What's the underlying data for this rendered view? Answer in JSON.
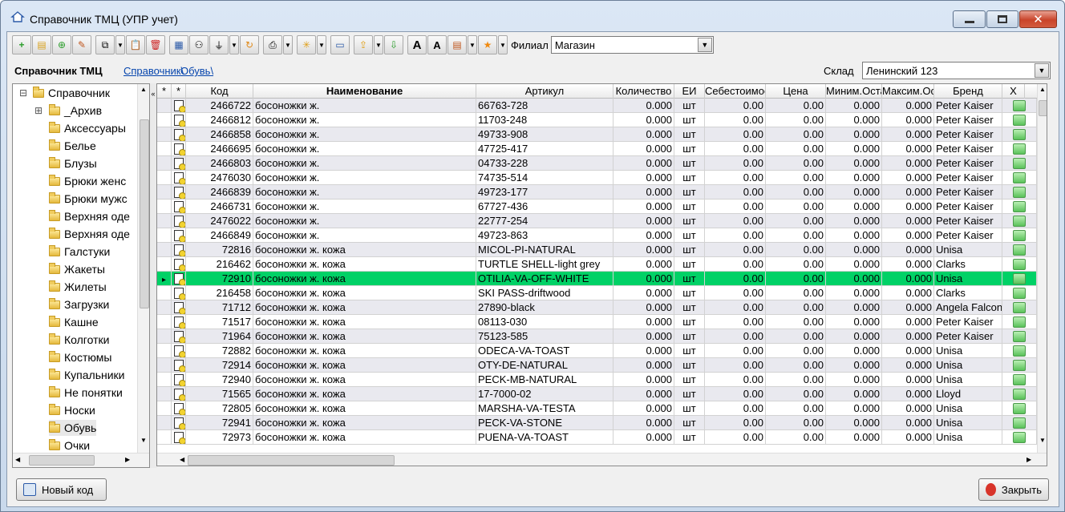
{
  "window": {
    "title": "Справочник ТМЦ (УПР учет)"
  },
  "toolbar": {
    "filial_label": "Филиал",
    "filial_value": "Магазин"
  },
  "breadcrumb": {
    "title": "Справочник ТМЦ",
    "links": [
      "Справочник\\",
      "Обувь\\"
    ]
  },
  "sklad": {
    "label": "Склад",
    "value": "Ленинский 123"
  },
  "tree": {
    "root": "Справочник",
    "items": [
      "_Архив",
      "Аксессуары",
      "Белье",
      "Блузы",
      "Брюки женс",
      "Брюки мужс",
      "Верхняя оде",
      "Верхняя оде",
      "Галстуки",
      "Жакеты",
      "Жилеты",
      "Загрузки",
      "Кашне",
      "Колготки",
      "Костюмы",
      "Купальники",
      "Не понятки",
      "Носки",
      "Обувь",
      "Очки"
    ]
  },
  "grid": {
    "headers": [
      "*",
      "*",
      "Код",
      "Наименование",
      "Артикул",
      "Количество",
      "ЕИ",
      "Себестоимость",
      "Цена",
      "Миним.Остаток",
      "Максим.Остаток",
      "Бренд",
      "Х"
    ],
    "rows": [
      [
        "2466722",
        "босоножки  ж.",
        "66763-728",
        "0.000",
        "шт",
        "0.00",
        "0.00",
        "0.000",
        "0.000",
        "Peter Kaiser"
      ],
      [
        "2466812",
        "босоножки  ж.",
        "11703-248",
        "0.000",
        "шт",
        "0.00",
        "0.00",
        "0.000",
        "0.000",
        "Peter Kaiser"
      ],
      [
        "2466858",
        "босоножки  ж.",
        "49733-908",
        "0.000",
        "шт",
        "0.00",
        "0.00",
        "0.000",
        "0.000",
        "Peter Kaiser"
      ],
      [
        "2466695",
        "босоножки  ж.",
        "47725-417",
        "0.000",
        "шт",
        "0.00",
        "0.00",
        "0.000",
        "0.000",
        "Peter Kaiser"
      ],
      [
        "2466803",
        "босоножки  ж.",
        "04733-228",
        "0.000",
        "шт",
        "0.00",
        "0.00",
        "0.000",
        "0.000",
        "Peter Kaiser"
      ],
      [
        "2476030",
        "босоножки  ж.",
        "74735-514",
        "0.000",
        "шт",
        "0.00",
        "0.00",
        "0.000",
        "0.000",
        "Peter Kaiser"
      ],
      [
        "2466839",
        "босоножки  ж.",
        "49723-177",
        "0.000",
        "шт",
        "0.00",
        "0.00",
        "0.000",
        "0.000",
        "Peter Kaiser"
      ],
      [
        "2466731",
        "босоножки  ж.",
        "67727-436",
        "0.000",
        "шт",
        "0.00",
        "0.00",
        "0.000",
        "0.000",
        "Peter Kaiser"
      ],
      [
        "2476022",
        "босоножки  ж.",
        "22777-254",
        "0.000",
        "шт",
        "0.00",
        "0.00",
        "0.000",
        "0.000",
        "Peter Kaiser"
      ],
      [
        "2466849",
        "босоножки  ж.",
        "49723-863",
        "0.000",
        "шт",
        "0.00",
        "0.00",
        "0.000",
        "0.000",
        "Peter Kaiser"
      ],
      [
        "72816",
        "босоножки  ж.  кожа",
        "MICOL-PI-NATURAL",
        "0.000",
        "шт",
        "0.00",
        "0.00",
        "0.000",
        "0.000",
        "Unisa"
      ],
      [
        "216462",
        "босоножки  ж.  кожа",
        "TURTLE  SHELL-light grey",
        "0.000",
        "шт",
        "0.00",
        "0.00",
        "0.000",
        "0.000",
        "Clarks"
      ],
      [
        "72910",
        "босоножки  ж.  кожа",
        "OTILIA-VA-OFF-WHITE",
        "0.000",
        "шт",
        "0.00",
        "0.00",
        "0.000",
        "0.000",
        "Unisa"
      ],
      [
        "216458",
        "босоножки  ж.  кожа",
        "SKI  PASS-driftwood",
        "0.000",
        "шт",
        "0.00",
        "0.00",
        "0.000",
        "0.000",
        "Clarks"
      ],
      [
        "71712",
        "босоножки  ж.  кожа",
        "27890-black",
        "0.000",
        "шт",
        "0.00",
        "0.00",
        "0.000",
        "0.000",
        "Angela Falconi"
      ],
      [
        "71517",
        "босоножки  ж.  кожа",
        "08113-030",
        "0.000",
        "шт",
        "0.00",
        "0.00",
        "0.000",
        "0.000",
        "Peter Kaiser"
      ],
      [
        "71964",
        "босоножки  ж.  кожа",
        "75123-585",
        "0.000",
        "шт",
        "0.00",
        "0.00",
        "0.000",
        "0.000",
        "Peter Kaiser"
      ],
      [
        "72882",
        "босоножки  ж.  кожа",
        "ODECA-VA-TOAST",
        "0.000",
        "шт",
        "0.00",
        "0.00",
        "0.000",
        "0.000",
        "Unisa"
      ],
      [
        "72914",
        "босоножки  ж.  кожа",
        "OTY-DE-NATURAL",
        "0.000",
        "шт",
        "0.00",
        "0.00",
        "0.000",
        "0.000",
        "Unisa"
      ],
      [
        "72940",
        "босоножки  ж.  кожа",
        "PECK-MB-NATURAL",
        "0.000",
        "шт",
        "0.00",
        "0.00",
        "0.000",
        "0.000",
        "Unisa"
      ],
      [
        "71565",
        "босоножки  ж.  кожа",
        "17-7000-02",
        "0.000",
        "шт",
        "0.00",
        "0.00",
        "0.000",
        "0.000",
        "Lloyd"
      ],
      [
        "72805",
        "босоножки  ж.  кожа",
        "MARSHA-VA-TESTA",
        "0.000",
        "шт",
        "0.00",
        "0.00",
        "0.000",
        "0.000",
        "Unisa"
      ],
      [
        "72941",
        "босоножки  ж.  кожа",
        "PECK-VA-STONE",
        "0.000",
        "шт",
        "0.00",
        "0.00",
        "0.000",
        "0.000",
        "Unisa"
      ],
      [
        "72973",
        "босоножки  ж.  кожа",
        "PUENA-VA-TOAST",
        "0.000",
        "шт",
        "0.00",
        "0.00",
        "0.000",
        "0.000",
        "Unisa"
      ]
    ],
    "selected_row": 12
  },
  "buttons": {
    "new_code": "Новый код",
    "close": "Закрыть"
  },
  "colors": {
    "selected_row": "#00d166",
    "alt_row": "#e9e9ef",
    "link": "#0645ad"
  }
}
